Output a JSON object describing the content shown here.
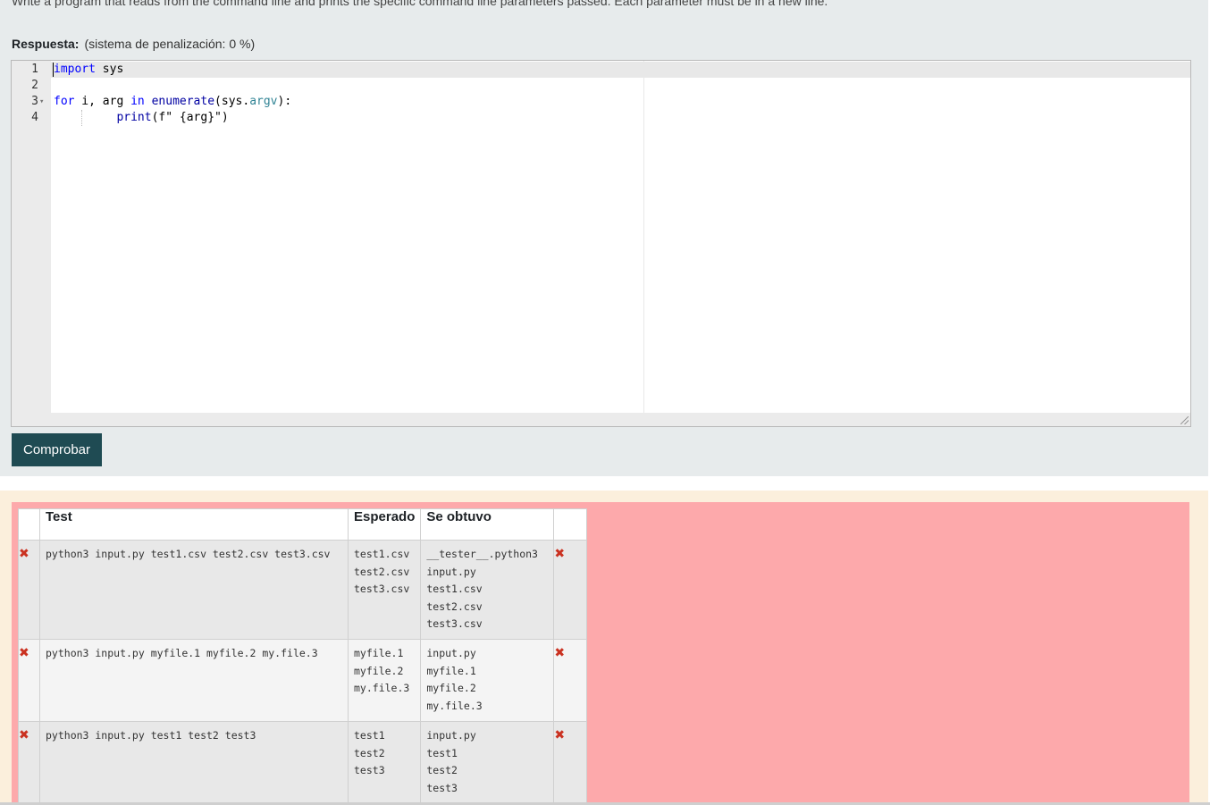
{
  "question": {
    "text": "Write a program that reads from the command line and prints the specific command line parameters passed.  Each parameter must be in a new line."
  },
  "answer": {
    "label": "Respuesta:",
    "penalty": "(sistema de penalización: 0 %)"
  },
  "editor": {
    "lines": [
      {
        "num": "1",
        "fold": "",
        "parts": [
          {
            "t": "import",
            "c": "kw"
          },
          {
            "t": " sys",
            "c": ""
          }
        ]
      },
      {
        "num": "2",
        "fold": "",
        "parts": []
      },
      {
        "num": "3",
        "fold": "▾",
        "parts": [
          {
            "t": "for",
            "c": "kw"
          },
          {
            "t": " i, arg ",
            "c": ""
          },
          {
            "t": "in",
            "c": "kw"
          },
          {
            "t": " ",
            "c": ""
          },
          {
            "t": "enumerate",
            "c": "fn"
          },
          {
            "t": "(sys.",
            "c": ""
          },
          {
            "t": "argv",
            "c": "var"
          },
          {
            "t": "):",
            "c": ""
          }
        ]
      },
      {
        "num": "4",
        "fold": "",
        "parts": [
          {
            "t": "         ",
            "c": ""
          },
          {
            "t": "print",
            "c": "fn"
          },
          {
            "t": "(f\" {arg}\")",
            "c": ""
          }
        ]
      }
    ]
  },
  "check_button": {
    "label": "Comprobar"
  },
  "results": {
    "headers": [
      "",
      "Test",
      "Esperado",
      "Se obtuvo",
      ""
    ],
    "rows": [
      {
        "status_left": "✖",
        "test": "python3 input.py test1.csv test2.csv test3.csv",
        "expected": [
          "test1.csv",
          "test2.csv",
          "test3.csv"
        ],
        "got": [
          "__tester__.python3",
          "input.py",
          "test1.csv",
          "test2.csv",
          "test3.csv"
        ],
        "status_right": "✖"
      },
      {
        "status_left": "✖",
        "test": "python3 input.py myfile.1 myfile.2 my.file.3",
        "expected": [
          "myfile.1",
          "myfile.2",
          "my.file.3"
        ],
        "got": [
          "input.py",
          "myfile.1",
          "myfile.2",
          "my.file.3"
        ],
        "status_right": "✖"
      },
      {
        "status_left": "✖",
        "test": "python3 input.py test1 test2 test3",
        "expected": [
          "test1",
          "test2",
          "test3"
        ],
        "got": [
          "input.py",
          "test1",
          "test2",
          "test3"
        ],
        "status_right": "✖"
      }
    ]
  },
  "colors": {
    "button_bg": "#1f4b53",
    "feedback_bg": "#fda9ab",
    "fail_icon": "#ca3120"
  }
}
